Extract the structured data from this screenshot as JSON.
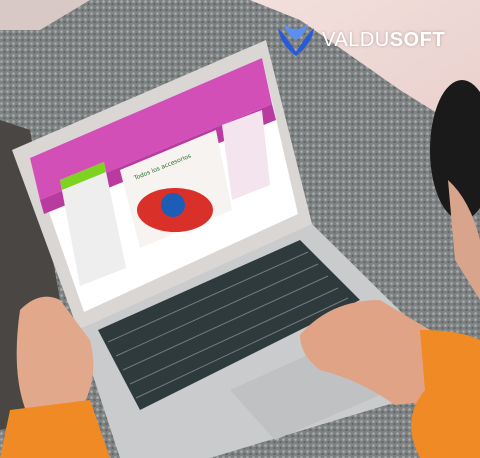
{
  "logo": {
    "light": "VALDU",
    "bold": "SOFT",
    "mark_color": "#2a5bd7"
  },
  "laptop_screen": {
    "banner_text": "Todos los accesorios",
    "theme_colors": {
      "header": "#d34fb8",
      "accent_green": "#7ed321",
      "nav_pink": "#f39ad8"
    }
  }
}
